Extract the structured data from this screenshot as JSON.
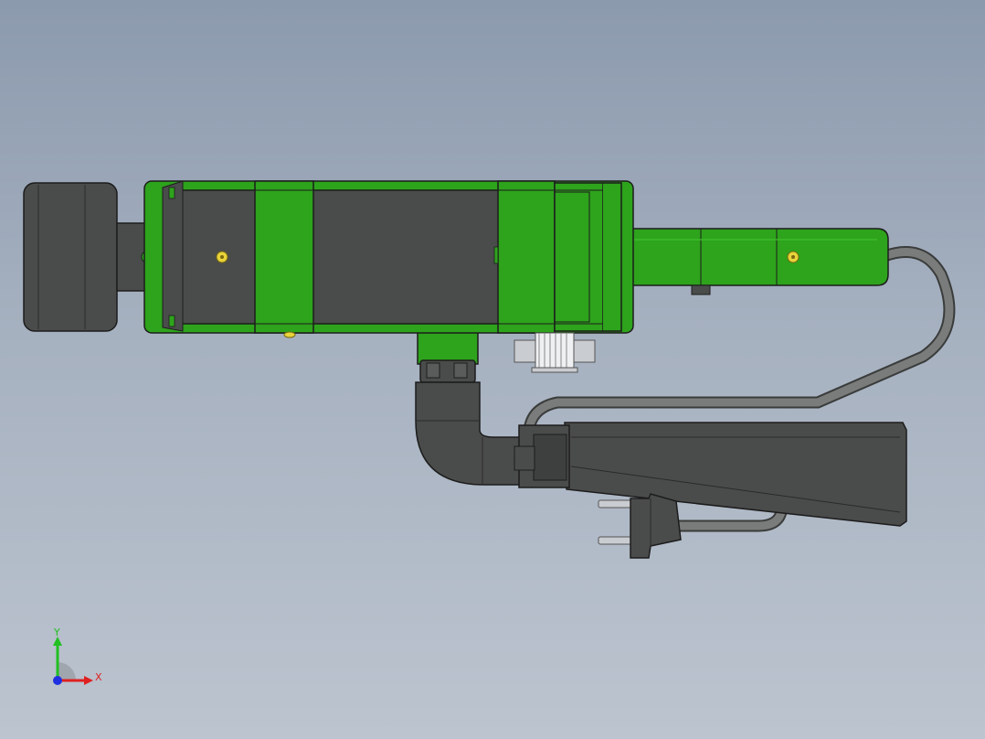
{
  "viewport": {
    "background_top": "#8c9aae",
    "background_bottom": "#bcc4cf"
  },
  "model": {
    "body_color": "#4a4c4b",
    "accent_color": "#2ea31c",
    "hose_color": "#6a6c6b",
    "screw_color": "#e8d33a",
    "parts": [
      "motor-housing",
      "end-cap",
      "green-band-front",
      "green-band-rear",
      "heater-tube",
      "nozzle-elbow",
      "handle",
      "power-cable",
      "power-plug",
      "belt-pulley"
    ]
  },
  "triad": {
    "y_label": "Y",
    "x_label": "X",
    "x_color": "#e02020",
    "y_color": "#20c020",
    "z_color": "#2030e0"
  }
}
